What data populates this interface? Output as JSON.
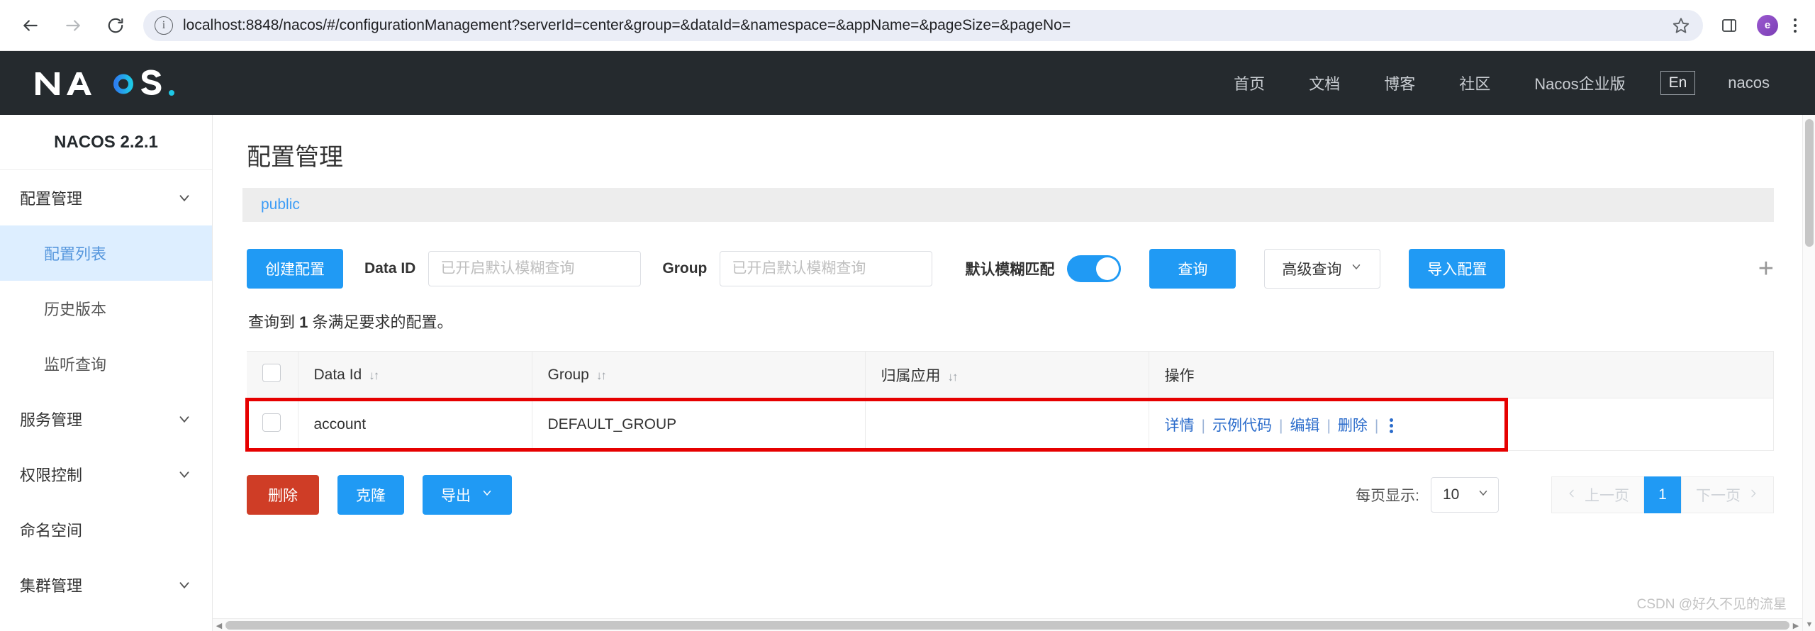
{
  "browser": {
    "url": "localhost:8848/nacos/#/configurationManagement?serverId=center&group=&dataId=&namespace=&appName=&pageSize=&pageNo=",
    "avatar_initial": "e"
  },
  "header": {
    "logo_text": "NACOS.",
    "nav": [
      {
        "label": "首页"
      },
      {
        "label": "文档"
      },
      {
        "label": "博客"
      },
      {
        "label": "社区"
      },
      {
        "label": "Nacos企业版"
      }
    ],
    "lang": "En",
    "user": "nacos"
  },
  "sidebar": {
    "title": "NACOS 2.2.1",
    "items": [
      {
        "label": "配置管理",
        "type": "group",
        "expandable": true
      },
      {
        "label": "配置列表",
        "type": "sub",
        "active": true
      },
      {
        "label": "历史版本",
        "type": "sub",
        "active": false
      },
      {
        "label": "监听查询",
        "type": "sub",
        "active": false
      },
      {
        "label": "服务管理",
        "type": "group",
        "expandable": true
      },
      {
        "label": "权限控制",
        "type": "group",
        "expandable": true
      },
      {
        "label": "命名空间",
        "type": "group",
        "expandable": false
      },
      {
        "label": "集群管理",
        "type": "group",
        "expandable": true
      }
    ]
  },
  "main": {
    "page_title": "配置管理",
    "namespace": "public",
    "toolbar": {
      "create_label": "创建配置",
      "dataid_label": "Data ID",
      "dataid_value": "",
      "dataid_placeholder": "已开启默认模糊查询",
      "group_label": "Group",
      "group_value": "",
      "group_placeholder": "已开启默认模糊查询",
      "switch_label": "默认模糊匹配",
      "switch_on": true,
      "query_label": "查询",
      "advanced_label": "高级查询",
      "import_label": "导入配置",
      "plus_label": "+"
    },
    "result_prefix": "查询到 ",
    "result_count": "1",
    "result_suffix": " 条满足要求的配置。",
    "table": {
      "columns": [
        "Data Id",
        "Group",
        "归属应用",
        "操作"
      ],
      "rows": [
        {
          "data_id": "account",
          "group": "DEFAULT_GROUP",
          "app": "",
          "actions": [
            "详情",
            "示例代码",
            "编辑",
            "删除"
          ]
        }
      ]
    },
    "footer": {
      "delete_label": "删除",
      "clone_label": "克隆",
      "export_label": "导出",
      "page_size_label": "每页显示:",
      "page_size_value": "10",
      "prev_label": "上一页",
      "next_label": "下一页",
      "current_page": "1"
    }
  },
  "watermark": "CSDN @好久不见的流星"
}
